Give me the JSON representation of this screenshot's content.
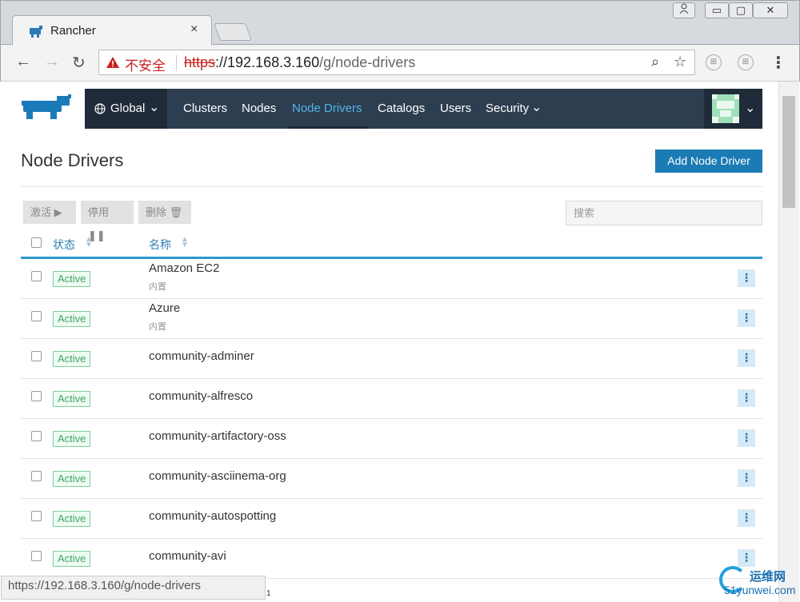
{
  "browser": {
    "tab_title": "Rancher",
    "tab_close": "×",
    "security_label": "不安全",
    "url_scheme": "https",
    "url_host": "://192.168.3.160",
    "url_path": "/g/node-drivers",
    "status_url": "https://192.168.3.160/g/node-drivers"
  },
  "nav": {
    "global_label": "Global",
    "links": [
      "Clusters",
      "Nodes",
      "Node Drivers",
      "Catalogs",
      "Users",
      "Security"
    ],
    "active": "Node Drivers"
  },
  "page": {
    "title": "Node Drivers",
    "add_button": "Add Node Driver"
  },
  "bulk_actions": {
    "activate": "激活",
    "deactivate": "停用",
    "delete": "删除"
  },
  "search": {
    "placeholder": "搜索"
  },
  "table": {
    "headers": {
      "state": "状态",
      "name": "名称"
    },
    "rows": [
      {
        "state": "Active",
        "name": "Amazon EC2",
        "sub": "内置"
      },
      {
        "state": "Active",
        "name": "Azure",
        "sub": "内置"
      },
      {
        "state": "Active",
        "name": "community-adminer",
        "sub": ""
      },
      {
        "state": "Active",
        "name": "community-alfresco",
        "sub": ""
      },
      {
        "state": "Active",
        "name": "community-artifactory-oss",
        "sub": ""
      },
      {
        "state": "Active",
        "name": "community-asciinema-org",
        "sub": ""
      },
      {
        "state": "Active",
        "name": "community-autospotting",
        "sub": ""
      },
      {
        "state": "Active",
        "name": "community-avi",
        "sub": ""
      }
    ]
  },
  "watermark": {
    "line1": "运维网",
    "line2": "51yunwei.com"
  },
  "page_marker": "1",
  "colors": {
    "nav_bg": "#2d3e50",
    "accent": "#1a7bb5",
    "active_green": "#3aa860"
  }
}
